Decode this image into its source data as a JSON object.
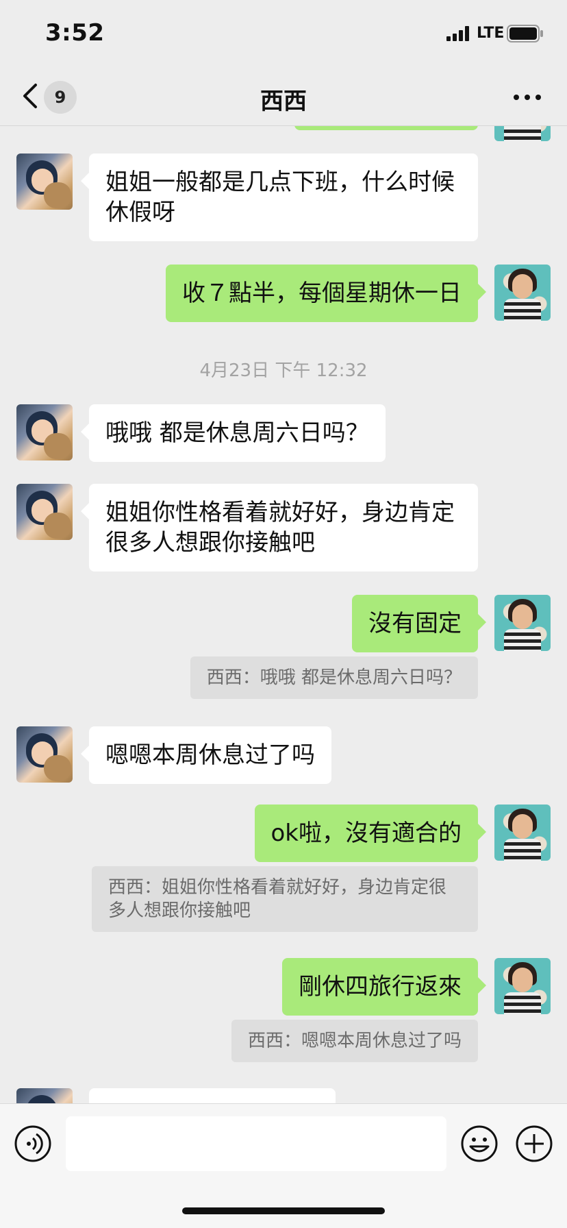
{
  "status": {
    "time": "3:52",
    "network": "LTE"
  },
  "nav": {
    "unread_count": "9",
    "title": "西西"
  },
  "messages": [
    {
      "from": "them",
      "text": "姐姐一般都是几点下班，什么时候休假呀"
    },
    {
      "from": "me",
      "text": "收７點半，每個星期休一日"
    },
    {
      "timestamp": "4月23日 下午 12:32"
    },
    {
      "from": "them",
      "text": "哦哦 都是休息周六日吗？"
    },
    {
      "from": "them",
      "text": "姐姐你性格看着就好好，身边肯定很多人想跟你接触吧"
    },
    {
      "from": "me",
      "text": "沒有固定",
      "quote": "西西：哦哦 都是休息周六日吗？"
    },
    {
      "from": "them",
      "text": "嗯嗯本周休息过了吗"
    },
    {
      "from": "me",
      "text": "ok啦，沒有適合的",
      "quote": "西西：姐姐你性格看着就好好，身边肯定很多人想跟你接触吧"
    },
    {
      "from": "me",
      "text": "剛休四旅行返來",
      "quote": "西西：嗯嗯本周休息过了吗"
    }
  ],
  "input": {
    "value": ""
  },
  "colors": {
    "background": "#ededed",
    "sent_bubble": "#a9ea7a",
    "received_bubble": "#ffffff",
    "quote_bg": "#dedede"
  }
}
